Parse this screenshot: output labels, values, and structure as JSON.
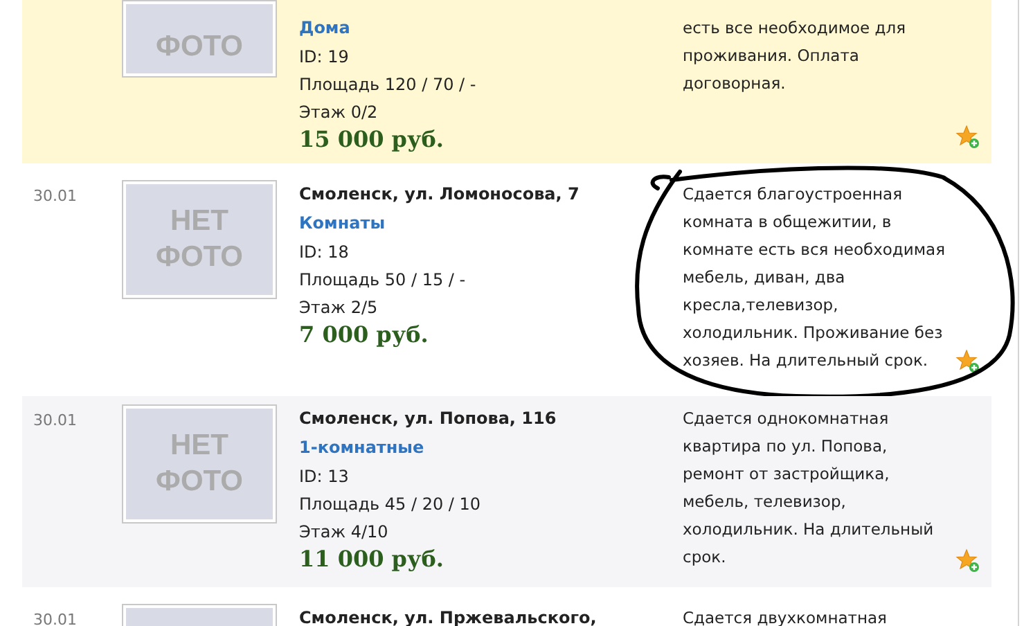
{
  "listings": [
    {
      "kind": "highlighted",
      "photo_lines": [
        "ФОТО"
      ],
      "category": "Дома",
      "id": "ID: 19",
      "area": "Площадь 120 / 70 / -",
      "floor": "Этаж 0/2",
      "price": "15 000 руб.",
      "description": "есть все необходимое для\nпроживания. Оплата\nдоговорная.",
      "circled": false
    },
    {
      "kind": "plain",
      "date": "30.01",
      "photo_lines": [
        "НЕТ",
        "ФОТО"
      ],
      "title": "Смоленск, ул. Ломоносова, 7",
      "category": "Комнаты",
      "id": "ID: 18",
      "area": "Площадь 50 / 15 / -",
      "floor": "Этаж 2/5",
      "price": "7 000 руб.",
      "description": "Сдается благоустроенная\nкомната в общежитии, в\nкомнате есть вся необходимая\nмебель, диван, два\nкресла,телевизор,\nхолодильник. Проживание без\nхозяев. На длительный срок.",
      "circled": true
    },
    {
      "kind": "shaded",
      "date": "30.01",
      "photo_lines": [
        "НЕТ",
        "ФОТО"
      ],
      "title": "Смоленск, ул. Попова, 116",
      "category": "1-комнатные",
      "id": "ID: 13",
      "area": "Площадь 45 / 20 / 10",
      "floor": "Этаж 4/10",
      "price": "11 000 руб.",
      "description": "Сдается однокомнатная\nквартира по ул. Попова,\nремонт от застройщика,\nмебель, телевизор,\nхолодильник. На длительный\nсрок.",
      "circled": false
    },
    {
      "kind": "plain",
      "date": "30.01",
      "title": "Смоленск, ул. Пржевальского,",
      "description": "Сдается двухкомнатная",
      "circled": false
    }
  ]
}
